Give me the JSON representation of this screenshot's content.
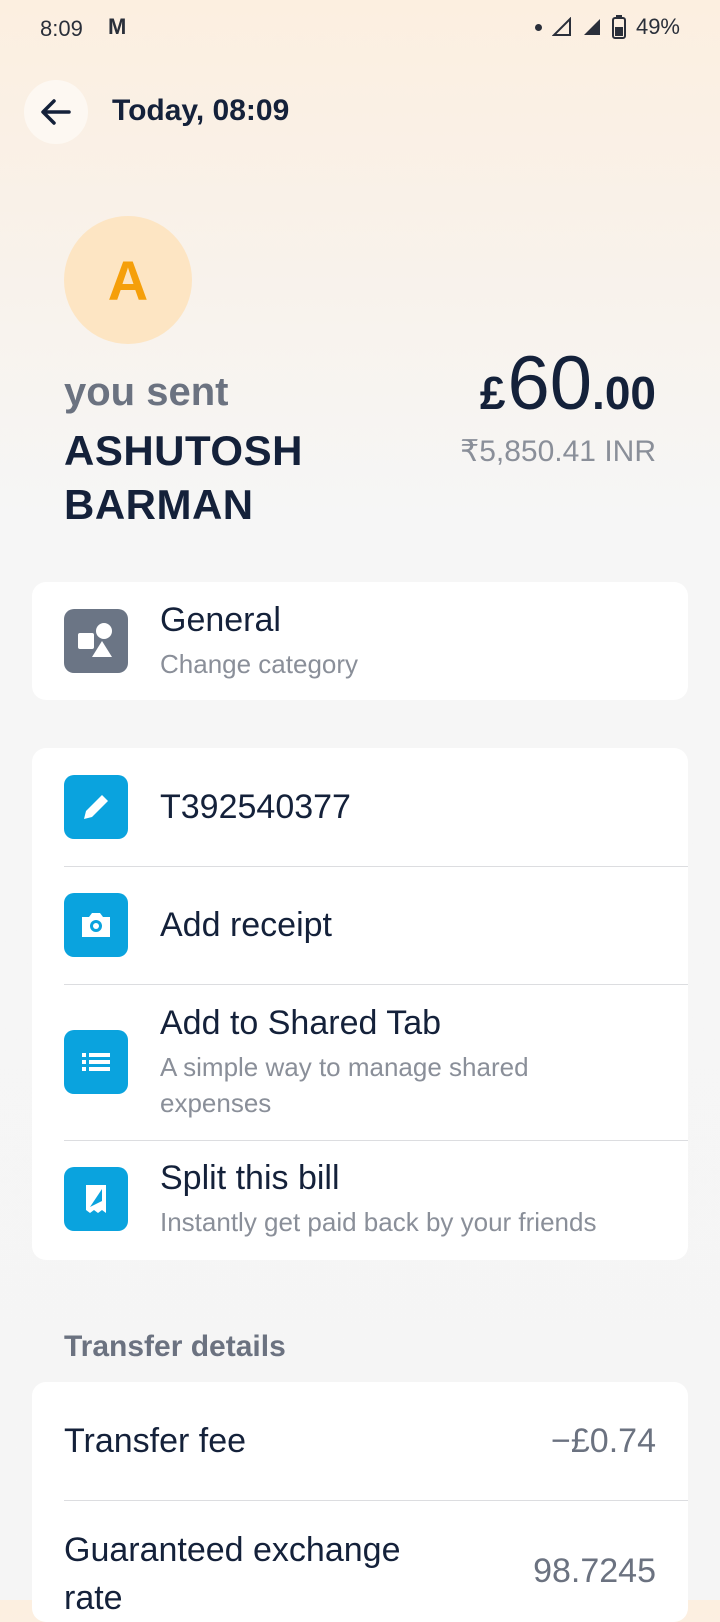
{
  "status_bar": {
    "time": "8:09",
    "mail": "M",
    "battery": "49%"
  },
  "header": {
    "title": "Today, 08:09"
  },
  "avatar": {
    "initial": "A"
  },
  "transfer": {
    "you_sent": "you sent",
    "recipient": "ASHUTOSH BARMAN",
    "amount_currency": "£",
    "amount_main": "60",
    "amount_decimal": ".00",
    "amount_converted": "₹5,850.41 INR"
  },
  "category": {
    "title": "General",
    "subtitle": "Change category",
    "icon": "category-shapes-icon"
  },
  "actions": [
    {
      "title": "T392540377",
      "icon": "pencil-icon"
    },
    {
      "title": "Add receipt",
      "icon": "camera-icon"
    },
    {
      "title": "Add to Shared Tab",
      "subtitle": "A simple way to manage shared expenses",
      "icon": "list-icon"
    },
    {
      "title": "Split this bill",
      "subtitle": "Instantly get paid back by your friends",
      "icon": "receipt-icon"
    }
  ],
  "details": {
    "section_title": "Transfer details",
    "rows": [
      {
        "label": "Transfer fee",
        "value": "−£0.74"
      },
      {
        "label": "Guaranteed exchange rate",
        "value": "98.7245"
      }
    ]
  },
  "colors": {
    "accent": "#0aa3de",
    "avatar_bg": "#fde5c3",
    "avatar_text": "#f59f0a",
    "text": "#14213a"
  }
}
